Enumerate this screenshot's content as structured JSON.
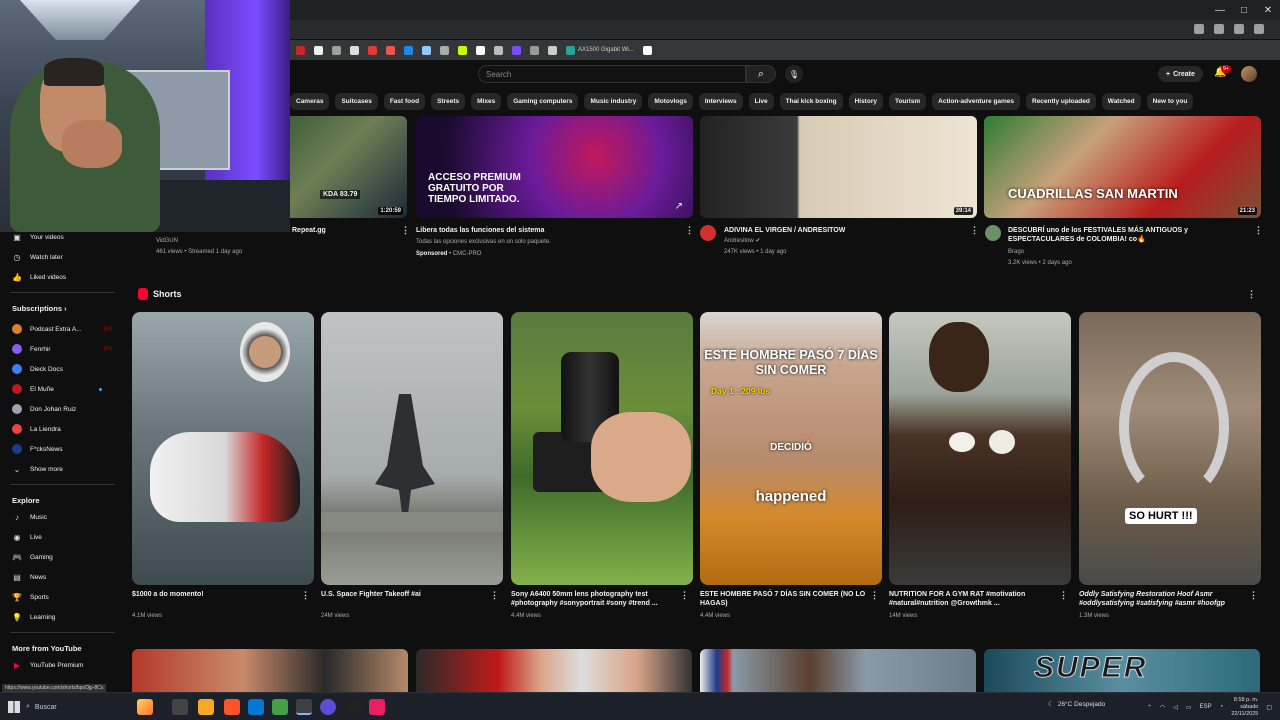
{
  "browser": {
    "bookmark_label": "AX1500 Gigabit Wi...",
    "window_controls": [
      "—",
      "□",
      "✕"
    ]
  },
  "header": {
    "search_placeholder": "Search",
    "create_label": "Create",
    "notification_count": "9+"
  },
  "chips": [
    "Cameras",
    "Suitcases",
    "Fast food",
    "Streets",
    "Mixes",
    "Gaming computers",
    "Music industry",
    "Motovlogs",
    "Interviews",
    "Live",
    "Thai kick boxing",
    "History",
    "Tourism",
    "Action-adventure games",
    "Recently uploaded",
    "Watched",
    "New to you"
  ],
  "sidebar": {
    "top_items": [
      {
        "label": "Your videos",
        "icon": "play-square-icon"
      },
      {
        "label": "Watch later",
        "icon": "clock-icon"
      },
      {
        "label": "Liked videos",
        "icon": "thumbs-up-icon"
      }
    ],
    "subscriptions_heading": "Subscriptions",
    "subscriptions": [
      {
        "label": "Podcast Extra A...",
        "color": "#d9822b",
        "badge": "live"
      },
      {
        "label": "Fenrhir",
        "color": "#8b5cf6",
        "badge": "live"
      },
      {
        "label": "Dieck Docs",
        "color": "#3b82f6",
        "badge": ""
      },
      {
        "label": "El Muñe",
        "color": "#b91c1c",
        "badge": "dot"
      },
      {
        "label": "Don Johan Ruiz",
        "color": "#9ca3af",
        "badge": ""
      },
      {
        "label": "La Liendra",
        "color": "#ef4444",
        "badge": ""
      },
      {
        "label": "F*cksNews",
        "color": "#1e3a8a",
        "badge": ""
      }
    ],
    "show_more": "Show more",
    "explore_heading": "Explore",
    "explore": [
      {
        "label": "Music",
        "icon": "music-note-icon"
      },
      {
        "label": "Live",
        "icon": "live-icon"
      },
      {
        "label": "Gaming",
        "icon": "gamepad-icon"
      },
      {
        "label": "News",
        "icon": "newspaper-icon"
      },
      {
        "label": "Sports",
        "icon": "trophy-icon"
      },
      {
        "label": "Learning",
        "icon": "lightbulb-icon"
      }
    ],
    "more_heading": "More from YouTube",
    "more": [
      {
        "label": "YouTube Premium",
        "icon": "youtube-premium-icon"
      }
    ]
  },
  "top_videos": [
    {
      "title": "Repeat.gg",
      "channel": "VidGUN",
      "meta": "461 views • Streamed 1 day ago",
      "duration": "1:20:59",
      "thumb_caption": "KDA 83.79"
    },
    {
      "title": "Libera todas las funciones del sistema",
      "channel": "Todas las opciones exclusivas en un solo paquete.",
      "meta": "CMC-PRO",
      "sponsored": "Sponsored",
      "thumb_caption": "ACCESO PREMIUM GRATUITO POR TIEMPO LIMITADO."
    },
    {
      "title": "ADIVINA EL VIRGEN / ANDRESITOW",
      "channel": "Andresitow ✔",
      "meta": "247K views • 1 day ago",
      "duration": "39:14"
    },
    {
      "title": "DESCUBRÍ uno de los FESTIVALES MÁS ANTIGUOS y ESPECTACULARES de COLOMBIA! co🔥",
      "channel": "Brago",
      "meta": "3.2K views • 2 days ago",
      "duration": "21:23",
      "thumb_caption": "CUADRILLAS SAN MARTIN"
    }
  ],
  "shorts": {
    "heading": "Shorts",
    "items": [
      {
        "title": "$1000 a do momento!",
        "views": "4.1M views"
      },
      {
        "title": "U.S. Space Fighter Takeoff #ai",
        "views": "24M views"
      },
      {
        "title": "Sony A6400  50mm lens photography test #photography #sonyportrait #sony #trend ...",
        "views": "4.4M views"
      },
      {
        "title": "ESTE HOMBRE PASÓ 7 DÍAS SIN COMER (NO LO HAGAS)",
        "views": "4.4M views",
        "overlay_top": "ESTE HOMBRE PASÓ 7 DÍAS SIN COMER",
        "overlay_day": "Day 1 : 209 lbs",
        "overlay_mid": "DECIDIÓ",
        "overlay_bottom": "happened"
      },
      {
        "title": "NUTRITION FOR A GYM RAT #motivation #natural#nutrition  @Growthmk ...",
        "views": "14M views"
      },
      {
        "title": "Oddly Satisfying Restoration Hoof Asmr #oddlysatisfying #satisfying #asmr #hoofgp",
        "views": "1.3M views",
        "overlay": "SO HURT !!!"
      }
    ]
  },
  "bottom_row_caption": "SUPER",
  "status_url": "https://www.youtube.com/shorts/bpoDjp-8Cs",
  "taskbar": {
    "search_label": "Buscar",
    "weather": "26°C  Despejado",
    "language": "ESP",
    "time": "8:58 p. m.",
    "day": "sábado",
    "date": "22/11/2025"
  }
}
